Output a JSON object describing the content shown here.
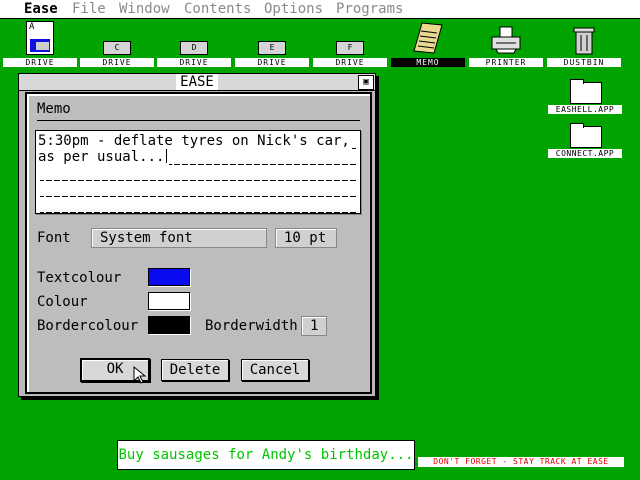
{
  "menu": {
    "items": [
      "Ease",
      "File",
      "Window",
      "Contents",
      "Options",
      "Programs"
    ]
  },
  "desktop": {
    "drives": [
      {
        "letter": "A",
        "label": "DRIVE"
      },
      {
        "letter": "C",
        "label": "DRIVE"
      },
      {
        "letter": "D",
        "label": "DRIVE"
      },
      {
        "letter": "E",
        "label": "DRIVE"
      },
      {
        "letter": "F",
        "label": "DRIVE"
      }
    ],
    "memo_label": "MEMO",
    "printer_label": "PRINTER",
    "dustbin_label": "DUSTBIN",
    "files": [
      "EASHELL.APP",
      "CONNECT.APP"
    ]
  },
  "window": {
    "title": "EASE"
  },
  "dialog": {
    "header": "Memo",
    "memo_lines": [
      "5:30pm - deflate tyres on Nick's car,",
      "as per usual...",
      "",
      "",
      ""
    ],
    "font_label": "Font",
    "font_value": "System font",
    "font_size": "10 pt",
    "textcolour_label": "Textcolour",
    "colour_label": "Colour",
    "bordercolour_label": "Bordercolour",
    "borderwidth_label": "Borderwidth",
    "borderwidth_value": "1",
    "textcolour": "#0b0bf0",
    "colour": "#ffffff",
    "bordercolour": "#000000",
    "ok_label": "OK",
    "delete_label": "Delete",
    "cancel_label": "Cancel"
  },
  "notes": {
    "green": "Buy sausages for Andy's birthday...",
    "red": "DON'T FORGET - STAY TRACK AT EASE"
  }
}
